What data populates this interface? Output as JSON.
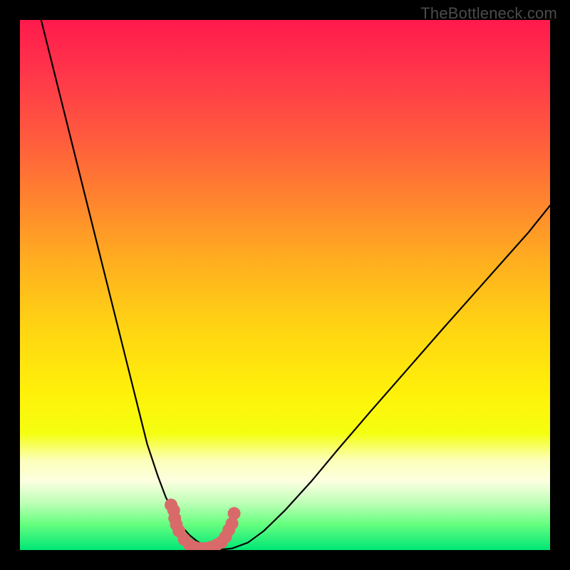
{
  "watermark": "TheBottleneck.com",
  "chart_data": {
    "type": "line",
    "title": "",
    "xlabel": "",
    "ylabel": "",
    "xlim": [
      0,
      100
    ],
    "ylim": [
      0,
      100
    ],
    "grid": false,
    "series": [
      {
        "name": "bottleneck-curve",
        "x": [
          4,
          6,
          8,
          10,
          12,
          14,
          16,
          18,
          20,
          22,
          24,
          26,
          27.5,
          29,
          30.5,
          32,
          33.5,
          35,
          36.5,
          38,
          40,
          43,
          46,
          50,
          55,
          60,
          66,
          73,
          80,
          88,
          96,
          100
        ],
        "values": [
          100,
          92,
          84,
          76,
          68,
          60,
          52,
          44,
          36,
          28,
          20,
          14,
          10,
          7,
          4.5,
          2.8,
          1.6,
          0.8,
          0.3,
          0.1,
          0.3,
          1.4,
          3.6,
          7.5,
          13,
          19,
          26,
          34,
          42,
          51,
          60,
          65
        ]
      }
    ],
    "markers": {
      "name": "highlight-dots",
      "color": "#d86a6a",
      "points": [
        {
          "x": 28.5,
          "y": 8.5
        },
        {
          "x": 29.0,
          "y": 7.5
        },
        {
          "x": 29.2,
          "y": 6.0
        },
        {
          "x": 29.5,
          "y": 4.8
        },
        {
          "x": 30.0,
          "y": 3.6
        },
        {
          "x": 31.0,
          "y": 2.0
        },
        {
          "x": 32.0,
          "y": 1.0
        },
        {
          "x": 33.0,
          "y": 0.5
        },
        {
          "x": 34.0,
          "y": 0.3
        },
        {
          "x": 35.0,
          "y": 0.3
        },
        {
          "x": 36.0,
          "y": 0.5
        },
        {
          "x": 37.0,
          "y": 0.9
        },
        {
          "x": 38.0,
          "y": 1.5
        },
        {
          "x": 38.8,
          "y": 2.5
        },
        {
          "x": 39.4,
          "y": 3.8
        },
        {
          "x": 40.0,
          "y": 5.0
        },
        {
          "x": 40.4,
          "y": 6.9
        }
      ]
    },
    "gradient_stops": [
      {
        "pos": 0,
        "color": "#ff1a4d"
      },
      {
        "pos": 70,
        "color": "#fff00a"
      },
      {
        "pos": 100,
        "color": "#00e676"
      }
    ]
  }
}
